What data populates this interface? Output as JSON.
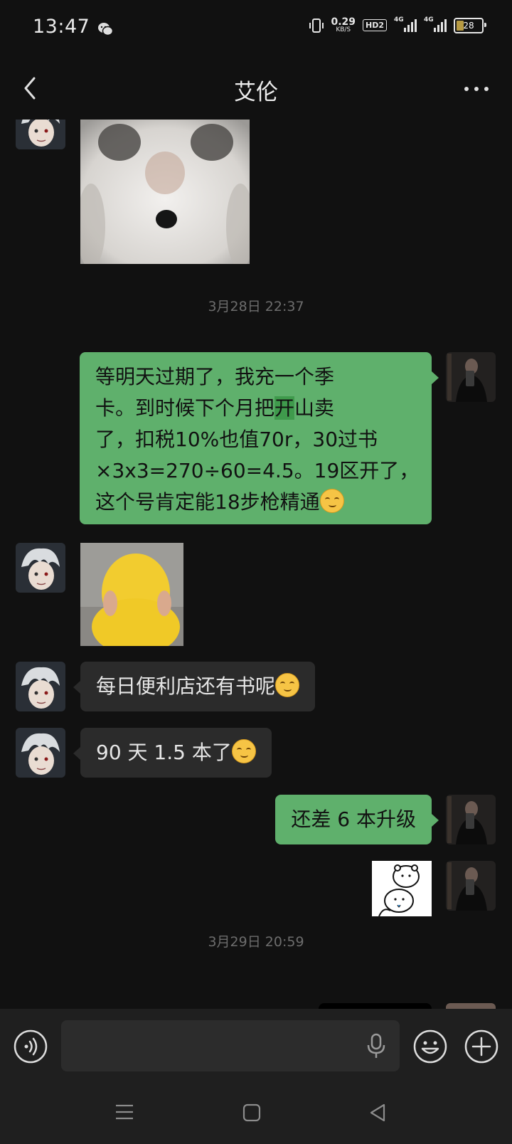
{
  "status_bar": {
    "time": "13:47",
    "net_speed": "0.29",
    "net_unit": "KB/S",
    "hd_label": "HD2",
    "signal1_label": "4G",
    "signal2_label": "4G",
    "battery": "28"
  },
  "header": {
    "title": "艾伦",
    "back_icon": "chevron-left-icon",
    "more_icon": "more-dots-icon"
  },
  "messages": [
    {
      "type": "image",
      "side": "in",
      "desc_icon": "hamster-sticker"
    },
    {
      "type": "timestamp",
      "text": "3月28日 22:37"
    },
    {
      "type": "text",
      "side": "out",
      "line1": "等明天过期了，我充一个季",
      "line2_a": "卡。到时候下个月把",
      "line2_hl": "开",
      "line2_b": "山卖",
      "line3": "了，扣税10%也值70r，30过书",
      "line4": "×3x3=270÷60=4.5。19区开了，",
      "line5": "这个号肯定能18步枪精通"
    },
    {
      "type": "image",
      "side": "in",
      "desc_icon": "yellow-hood-sticker"
    },
    {
      "type": "text",
      "side": "in",
      "text": "每日便利店还有书呢"
    },
    {
      "type": "text",
      "side": "in",
      "text": "90 天 1.5 本了"
    },
    {
      "type": "text",
      "side": "out",
      "text": "还差 6 本升级"
    },
    {
      "type": "image",
      "side": "out",
      "desc_icon": "bear-sticker"
    },
    {
      "type": "timestamp",
      "text": "3月29日 20:59"
    }
  ],
  "input_bar": {
    "voice_icon": "voice-icon",
    "mic_icon": "mic-icon",
    "emoji_icon": "emoji-icon",
    "plus_icon": "plus-icon"
  },
  "nav_bar": {
    "menu_icon": "menu-icon",
    "home_icon": "home-icon",
    "back_icon": "back-triangle-icon"
  },
  "colors": {
    "background": "#111111",
    "bubble_out": "#5fb06c",
    "bubble_in": "#2b2b2b",
    "timestamp": "#6d6d6d"
  }
}
